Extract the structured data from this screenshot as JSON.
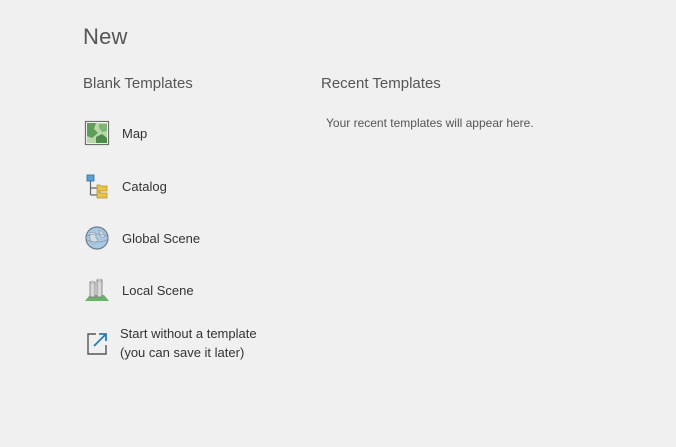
{
  "title": "New",
  "blank_templates": {
    "heading": "Blank Templates",
    "items": [
      {
        "label": "Map",
        "icon": "map-icon"
      },
      {
        "label": "Catalog",
        "icon": "catalog-icon"
      },
      {
        "label": "Global Scene",
        "icon": "globe-icon"
      },
      {
        "label": "Local Scene",
        "icon": "local-scene-icon"
      },
      {
        "label_line1": "Start without a template",
        "label_line2": "(you can save it later)",
        "icon": "open-new-icon"
      }
    ]
  },
  "recent_templates": {
    "heading": "Recent Templates",
    "empty_message": "Your recent templates will appear here."
  },
  "colors": {
    "background": "#f0f0f0",
    "text": "#333333",
    "heading": "#555555",
    "accent_blue": "#2a7ab8",
    "map_green": "#6fae6b",
    "folder_yellow": "#e8c34a"
  }
}
